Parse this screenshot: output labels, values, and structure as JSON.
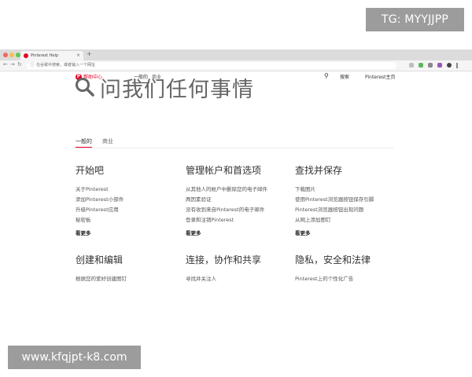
{
  "watermarks": {
    "top": "TG: MYYJJPP",
    "bottom": "www.kfqjpt-k8.com"
  },
  "browser": {
    "tab_title": "Pinterest Help",
    "tab_close": "×",
    "new_tab": "+",
    "address_text": "在谷歌中搜索，或者输入一个网址",
    "back": "←",
    "forward": "→",
    "reload": "↻"
  },
  "header": {
    "logo_glyph": "P",
    "brand": "帮助中心",
    "nav": [
      "一般的",
      "商业"
    ],
    "search_label": "搜索",
    "home_link": "Pinterest主页"
  },
  "hero": {
    "title": "问我们任何事情"
  },
  "tabs": [
    "一般的",
    "商业"
  ],
  "categories": [
    {
      "title": "开始吧",
      "links": [
        "关于Pinterest",
        "添加Pinterest小部件",
        "升级Pinterest应用",
        "秘密板"
      ],
      "more": "看更多"
    },
    {
      "title": "管理帐户和首选项",
      "links": [
        "从其他人的帐户中删除您的电子邮件",
        "两因素验证",
        "没有收到来自Pinterest的电子邮件",
        "登录和注销Pinterest"
      ],
      "more": "看更多"
    },
    {
      "title": "查找并保存",
      "links": [
        "下载图片",
        "使用Pinterest浏览器按钮保存引脚",
        "Pinterest浏览器按钮出现问题",
        "从网上添加图钉"
      ],
      "more": "看更多"
    },
    {
      "title": "创建和编辑",
      "links": [
        "根据您的爱好创建图钉"
      ],
      "more": ""
    },
    {
      "title": "连接，协作和共享",
      "links": [
        "寻找并关注人"
      ],
      "more": ""
    },
    {
      "title": "隐私，安全和法律",
      "links": [
        "Pinterest上的个性化广告"
      ],
      "more": ""
    }
  ],
  "colors": {
    "brand": "#e60023",
    "text": "#333333",
    "watermark_bg": "#9c9c9c"
  }
}
